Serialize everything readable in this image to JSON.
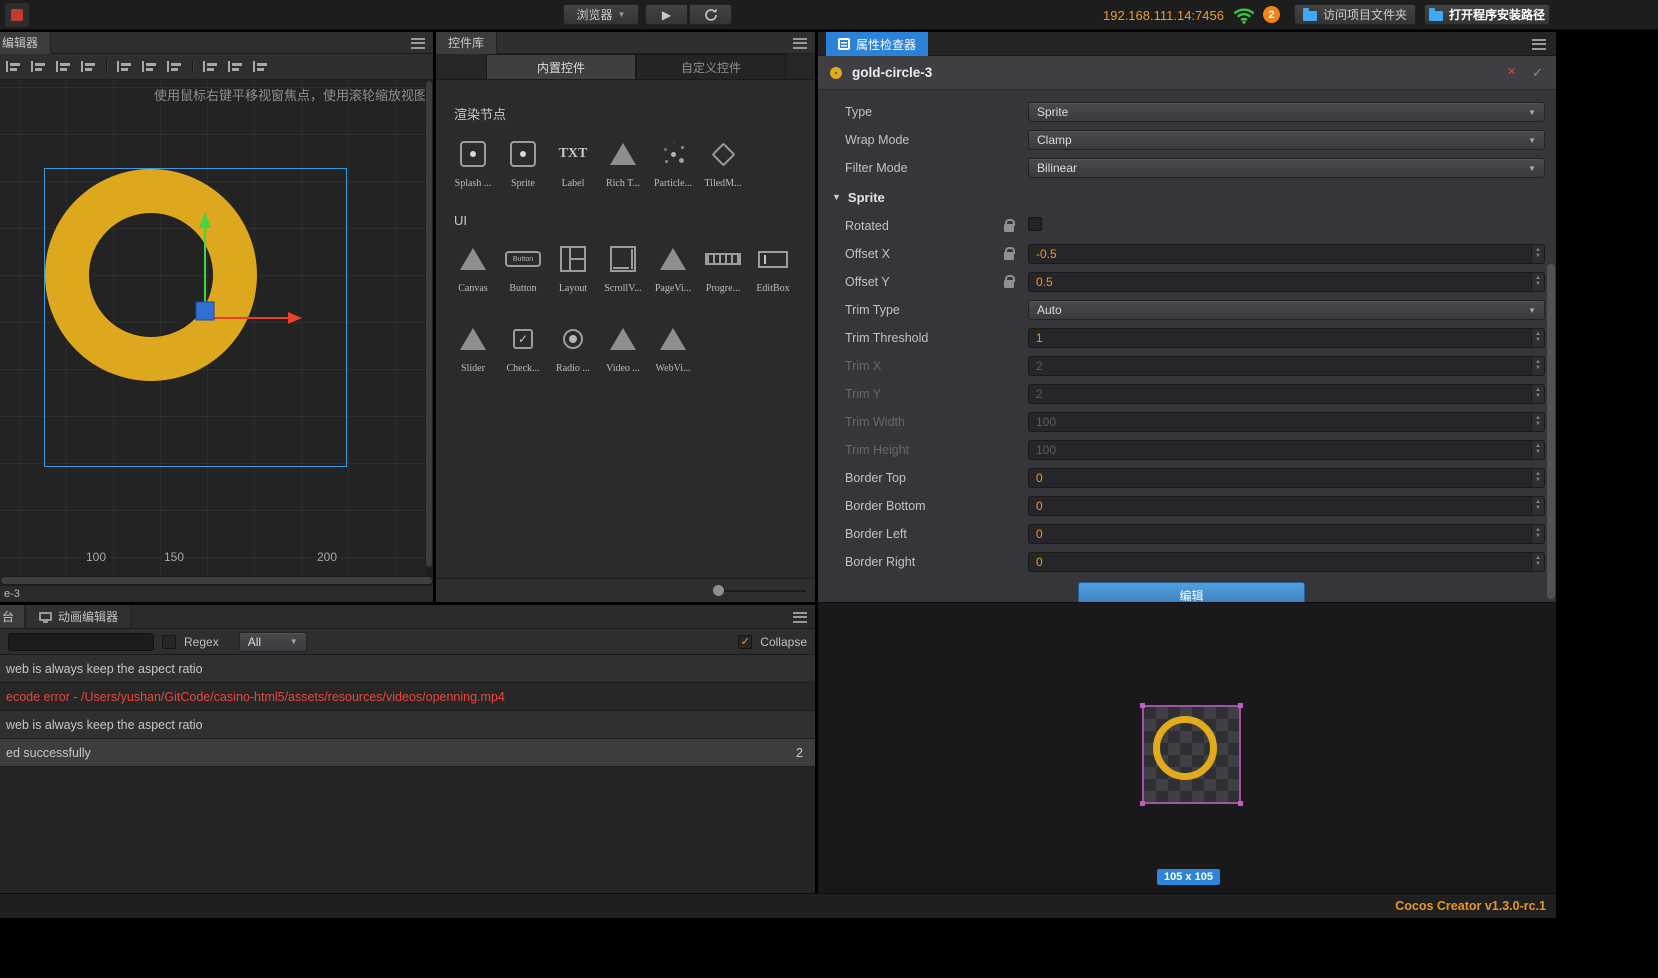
{
  "icons": {
    "chevron_down": "▼",
    "spinner_up": "▲",
    "spinner_down": "▼",
    "play": "▶",
    "refresh": "↻",
    "check": "✓",
    "close": "×"
  },
  "topbar": {
    "browser_label": "浏览器",
    "address": "192.168.111.14:7456",
    "badge_count": "2",
    "open_project_label": "访问项目文件夹",
    "open_install_label": "打开程序安装路径"
  },
  "scene": {
    "tab_label": "编辑器",
    "hint": "使用鼠标右键平移视窗焦点，使用滚轮缩放视图",
    "ruler_marks": [
      "100",
      "150",
      "200"
    ],
    "breadcrumb": "e-3",
    "node_color": "#e2ab1c",
    "toolbar_icons": [
      "align-top-icon",
      "align-middle-icon",
      "align-bottom-icon",
      "align-stretch-icon",
      "align-left-icon",
      "align-center-icon",
      "align-right-icon",
      "distribute-horizontal-icon",
      "distribute-vertical-icon",
      "distribute-grid-icon"
    ]
  },
  "library": {
    "tab_label": "控件库",
    "tabs": [
      {
        "label": "内置控件",
        "active": true
      },
      {
        "label": "自定义控件",
        "active": false
      }
    ],
    "sections": [
      {
        "title": "渲染节点",
        "rows": [
          [
            {
              "label": "Splash ...",
              "icon": "splash"
            },
            {
              "label": "Sprite",
              "icon": "sprite"
            },
            {
              "label": "Label",
              "icon": "txt"
            },
            {
              "label": "Rich T...",
              "icon": "triangle"
            },
            {
              "label": "Particle...",
              "icon": "particle"
            },
            {
              "label": "TiledM...",
              "icon": "diamond"
            }
          ]
        ]
      },
      {
        "title": "UI",
        "rows": [
          [
            {
              "label": "Canvas",
              "icon": "triangle"
            },
            {
              "label": "Button",
              "icon": "button"
            },
            {
              "label": "Layout",
              "icon": "layout"
            },
            {
              "label": "ScrollV...",
              "icon": "scrollview"
            },
            {
              "label": "PageVi...",
              "icon": "triangle"
            },
            {
              "label": "Progre...",
              "icon": "progress"
            },
            {
              "label": "EditBox",
              "icon": "editbox"
            }
          ],
          [
            {
              "label": "Slider",
              "icon": "triangle"
            },
            {
              "label": "Check...",
              "icon": "checkbox"
            },
            {
              "label": "Radio ...",
              "icon": "radio"
            },
            {
              "label": "Video ...",
              "icon": "triangle"
            },
            {
              "label": "WebVi...",
              "icon": "triangle"
            }
          ]
        ]
      }
    ]
  },
  "inspector": {
    "tab_label": "属性检查器",
    "node_name": "gold-circle-3",
    "top_rows": [
      {
        "label": "Type",
        "control": "select",
        "value": "Sprite"
      },
      {
        "label": "Wrap Mode",
        "control": "select",
        "value": "Clamp"
      },
      {
        "label": "Filter Mode",
        "control": "select",
        "value": "Bilinear"
      }
    ],
    "section_label": "Sprite",
    "sprite_rows": [
      {
        "label": "Rotated",
        "control": "checkbox",
        "checked": false,
        "locked": true
      },
      {
        "label": "Offset X",
        "control": "input",
        "value": "-0.5",
        "locked": true
      },
      {
        "label": "Offset Y",
        "control": "input",
        "value": "0.5",
        "locked": true
      },
      {
        "label": "Trim Type",
        "control": "select",
        "value": "Auto"
      },
      {
        "label": "Trim Threshold",
        "control": "input",
        "value": "1"
      },
      {
        "label": "Trim X",
        "control": "input",
        "value": "2",
        "disabled": true
      },
      {
        "label": "Trim Y",
        "control": "input",
        "value": "2",
        "disabled": true
      },
      {
        "label": "Trim Width",
        "control": "input",
        "value": "100",
        "disabled": true
      },
      {
        "label": "Trim Height",
        "control": "input",
        "value": "100",
        "disabled": true
      },
      {
        "label": "Border Top",
        "control": "input",
        "value": "0"
      },
      {
        "label": "Border Bottom",
        "control": "input",
        "value": "0"
      },
      {
        "label": "Border Left",
        "control": "input",
        "value": "0"
      },
      {
        "label": "Border Right",
        "control": "input",
        "value": "0"
      }
    ],
    "edit_button_label": "编辑",
    "preview_size": "105 x 105"
  },
  "console": {
    "left_tab_label": "台",
    "animation_tab_label": "动画编辑器",
    "search_placeholder": "",
    "regex_label": "Regex",
    "filter_value": "All",
    "collapse_label": "Collapse",
    "collapse_checked": true,
    "logs": [
      {
        "text": "web is always keep the aspect ratio",
        "type": "info",
        "count": ""
      },
      {
        "text": "ecode error - /Users/yushan/GitCode/casino-html5/assets/resources/videos/openning.mp4",
        "type": "error",
        "count": ""
      },
      {
        "text": "web is always keep the aspect ratio",
        "type": "info",
        "count": ""
      },
      {
        "text": "ed successfully",
        "type": "info",
        "selected": true,
        "count": "2"
      }
    ]
  },
  "statusbar": {
    "version_label": "Cocos Creator v1.3.0-rc.1"
  },
  "colors": {
    "accent_blue": "#2c82d8",
    "value_orange": "#f7941e",
    "gold": "#e2ab1c",
    "error_red": "#e8473c",
    "wifi_green": "#35c93f",
    "selection_blue": "#3b99e0",
    "gizmo_green": "#41d741",
    "gizmo_red": "#e8402a",
    "gizmo_blue": "#2f6fd6",
    "preview_border_purple": "#a352a8"
  }
}
